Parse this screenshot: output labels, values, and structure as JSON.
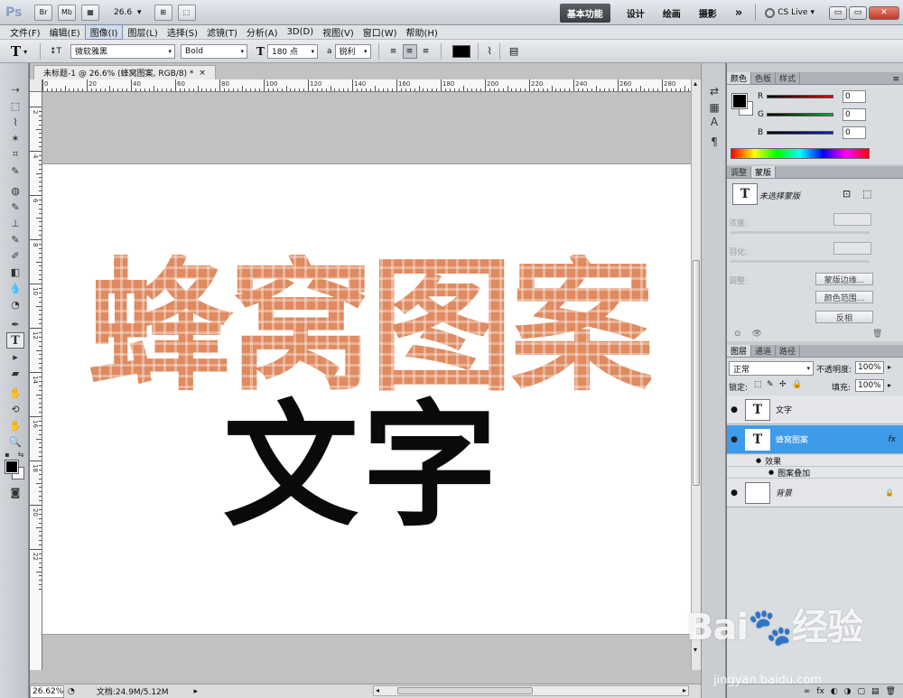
{
  "appbar": {
    "logo": "Ps",
    "bridge": "Br",
    "minibridge": "Mb",
    "zoom": "26.6",
    "workspaces": [
      "基本功能",
      "设计",
      "绘画",
      "摄影"
    ],
    "more": "»",
    "cslive": "CS Live",
    "dropdown_glyph": "▾",
    "view_icons": [
      "▦",
      "⊞",
      "⬚"
    ],
    "window_buttons": [
      "▭",
      "▭",
      "✕"
    ]
  },
  "menu": [
    "文件(F)",
    "编辑(E)",
    "图像(I)",
    "图层(L)",
    "选择(S)",
    "滤镜(T)",
    "分析(A)",
    "3D(D)",
    "视图(V)",
    "窗口(W)",
    "帮助(H)"
  ],
  "options": {
    "tool_glyph": "T",
    "dropdown_glyph": "▾",
    "orient_glyph": "↕T",
    "font_family": "微软雅黑",
    "font_style": "Bold",
    "size_icon": "T",
    "font_size": "180 点",
    "aa_icon": "a",
    "antialias": "锐利",
    "align_glyphs": [
      "≡",
      "≡",
      "≡"
    ],
    "warp_glyph": "⌇",
    "panel_glyph": "▤"
  },
  "tools": [
    "⇢",
    "⬚",
    "⌇",
    "✶",
    "⌗",
    "✎",
    "◍",
    "✎",
    "⊥",
    "✎",
    "✐",
    "◧",
    "💧",
    "◔",
    "✒",
    "T",
    "▸",
    "▰",
    "✋",
    "⟲",
    "✋",
    "🔍",
    "⟳"
  ],
  "tool_extra": [
    "▪",
    "⇆",
    "◙"
  ],
  "doc": {
    "tab_title": "未标题-1 @ 26.6% (蜂窝图案, RGB/8) *",
    "tab_close": "×",
    "ruler_h": [
      "0",
      "20",
      "40",
      "60",
      "80",
      "100",
      "120",
      "140",
      "160",
      "180",
      "200",
      "220",
      "240",
      "260",
      "280"
    ],
    "ruler_v": [
      "2",
      "4",
      "6",
      "8",
      "10",
      "12",
      "14",
      "16",
      "18",
      "20",
      "22"
    ],
    "text_honeycomb": "蜂窝图案",
    "text_word": "文字",
    "status_zoom": "26.62%",
    "status_doc": "文档:24.9M/5.12M",
    "status_icon": "◔",
    "arrow_right": "▸",
    "arrow_left": "◂",
    "arrow_up": "▴",
    "arrow_down": "▾"
  },
  "dock_icons": [
    "⇄",
    "▦",
    "A",
    "¶"
  ],
  "color_panel": {
    "tabs": [
      "颜色",
      "色板",
      "样式"
    ],
    "channels": [
      {
        "label": "R",
        "value": "0",
        "color": "#d01010"
      },
      {
        "label": "G",
        "value": "0",
        "color": "#10b020"
      },
      {
        "label": "B",
        "value": "0",
        "color": "#1020d0"
      }
    ],
    "menu_glyph": "≡"
  },
  "mask_panel": {
    "tabs": [
      "调整",
      "蒙版"
    ],
    "title": "未选择蒙版",
    "density_label": "浓度:",
    "feather_label": "羽化:",
    "refine_label": "调整:",
    "btn_edge": "蒙版边缘...",
    "btn_range": "颜色范围...",
    "btn_invert": "反相",
    "thumb_glyph": "T",
    "icon1": "⊡",
    "icon2": "⬚",
    "foot_icons": [
      "⊙",
      "👁",
      "🗑"
    ]
  },
  "layers_panel": {
    "tabs": [
      "图层",
      "通道",
      "路径"
    ],
    "blend_mode": "正常",
    "opacity_label": "不透明度:",
    "opacity": "100%",
    "lock_label": "锁定:",
    "lock_icons": [
      "⬚",
      "✎",
      "✢",
      "🔒"
    ],
    "fill_label": "填充:",
    "fill": "100%",
    "eye_glyph": "●",
    "fx_glyph": "fx",
    "lock_glyph": "🔒",
    "layers": [
      {
        "name": "文字",
        "type": "T",
        "selected": false
      },
      {
        "name": "蜂窝图案",
        "type": "T",
        "selected": true
      },
      {
        "name": "背景",
        "type": "bg",
        "selected": false
      }
    ],
    "effects_label": "效果",
    "effect_item": "图案叠加",
    "foot_icons": [
      "∞",
      "fx",
      "◐",
      "◑",
      "▢",
      "▤",
      "🗑"
    ]
  },
  "watermark": {
    "logo": "Bai🐾经验",
    "url": "jingyan.baidu.com"
  }
}
